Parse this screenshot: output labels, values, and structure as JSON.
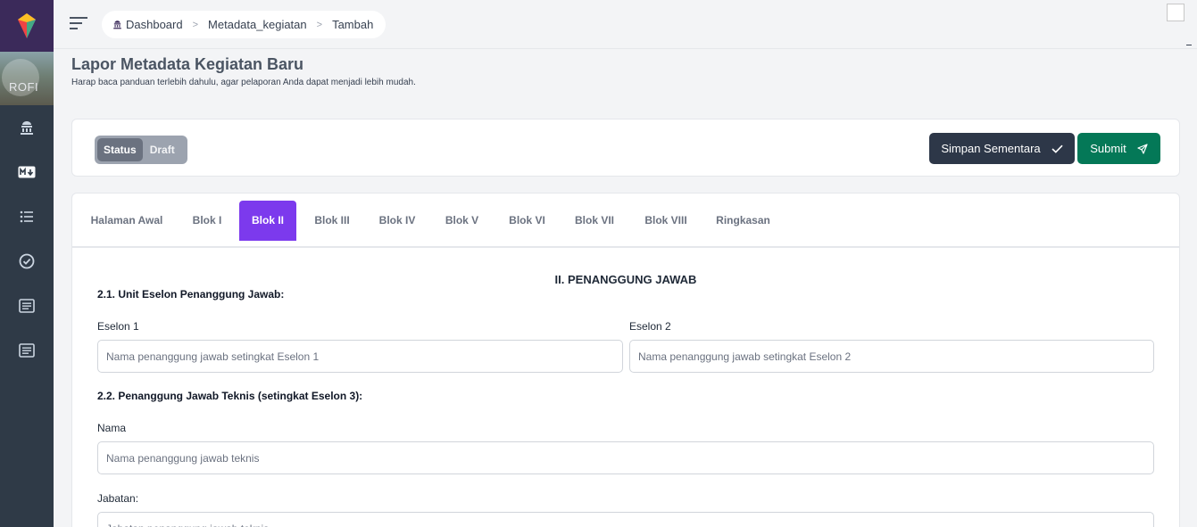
{
  "sidebar": {
    "photo_text": "ROFI",
    "icons": [
      "palace-icon",
      "markdown-icon",
      "list-icon",
      "check-circle-icon",
      "document-icon",
      "document-icon-2"
    ]
  },
  "breadcrumb": {
    "items": [
      "Dashboard",
      "Metadata_kegiatan",
      "Tambah"
    ]
  },
  "page": {
    "title": "Lapor Metadata Kegiatan Baru",
    "subtitle": "Harap baca panduan terlebih dahulu, agar pelaporan Anda dapat menjadi lebih mudah."
  },
  "status": {
    "label": "Status",
    "value": "Draft"
  },
  "actions": {
    "save_label": "Simpan Sementara",
    "submit_label": "Submit"
  },
  "tabs": [
    {
      "label": "Halaman Awal",
      "active": false
    },
    {
      "label": "Blok I",
      "active": false
    },
    {
      "label": "Blok II",
      "active": true
    },
    {
      "label": "Blok III",
      "active": false
    },
    {
      "label": "Blok IV",
      "active": false
    },
    {
      "label": "Blok V",
      "active": false
    },
    {
      "label": "Blok VI",
      "active": false
    },
    {
      "label": "Blok VII",
      "active": false
    },
    {
      "label": "Blok VIII",
      "active": false
    },
    {
      "label": "Ringkasan",
      "active": false
    }
  ],
  "form": {
    "section_title": "II. PENANGGUNG JAWAB",
    "unit_heading": "2.1. Unit Eselon Penanggung Jawab:",
    "eselon1_label": "Eselon 1",
    "eselon1_placeholder": "Nama penanggung jawab setingkat Eselon 1",
    "eselon1_value": "",
    "eselon2_label": "Eselon 2",
    "eselon2_placeholder": "Nama penanggung jawab setingkat Eselon 2",
    "eselon2_value": "",
    "tech_heading": "2.2. Penanggung Jawab Teknis (setingkat Eselon 3):",
    "nama_label": "Nama",
    "nama_placeholder": "Nama penanggung jawab teknis",
    "nama_value": "",
    "jabatan_label": "Jabatan:",
    "jabatan_placeholder": "Jabatan penanggung jawab teknis",
    "jabatan_value": ""
  },
  "colors": {
    "sidebar": "#2f3a47",
    "accent_tab": "#7c3aed",
    "save_button": "#2d3748",
    "submit_button": "#047857"
  }
}
